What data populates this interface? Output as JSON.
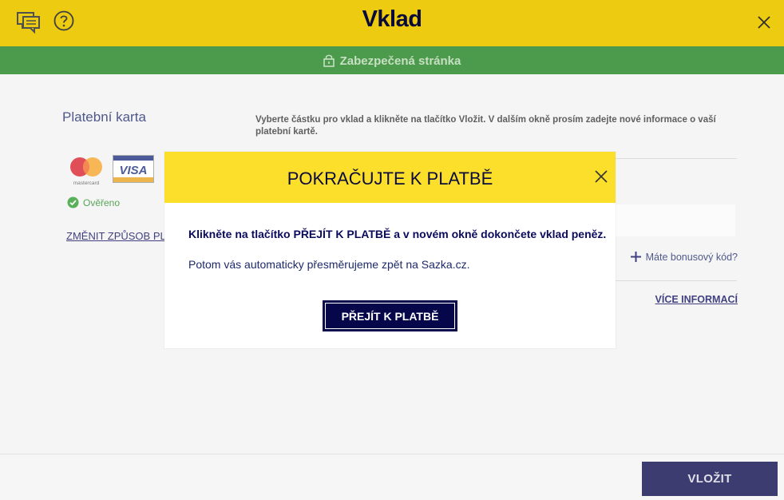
{
  "header": {
    "title": "Vklad",
    "icons": {
      "chat": "chat-icon",
      "help": "help-icon",
      "close": "close-icon"
    }
  },
  "secure_bar": {
    "text": "Zabezpečená stránka",
    "icon": "lock-icon"
  },
  "payment_method": {
    "title": "Platební karta",
    "cards": [
      "mastercard",
      "visa"
    ],
    "verified_label": "Ověřeno",
    "change_link": "ZMĚNIT ZPŮSOB PLATBY"
  },
  "main": {
    "instructions": "Vyberte částku pro vklad a klikněte na tlačítko Vložit. V dalším okně prosím zadejte nové informace o vaší platební kartě.",
    "bonus_link": "Máte bonusový kód?",
    "more_info_link": "VÍCE INFORMACÍ"
  },
  "footer": {
    "deposit_button": "VLOŽIT"
  },
  "modal": {
    "title": "POKRAČUJTE K PLATBĚ",
    "text_bold": "Klikněte na tlačítko PŘEJÍT K PLATBĚ a v novém okně dokončete vklad peněz.",
    "text_regular": "Potom vás automaticky přesměrujeme zpět na Sazka.cz.",
    "button": "PŘEJÍT K PLATBĚ"
  },
  "colors": {
    "header_yellow": "#fbd813",
    "secure_green": "#4c9a4c",
    "navy": "#06064a"
  }
}
